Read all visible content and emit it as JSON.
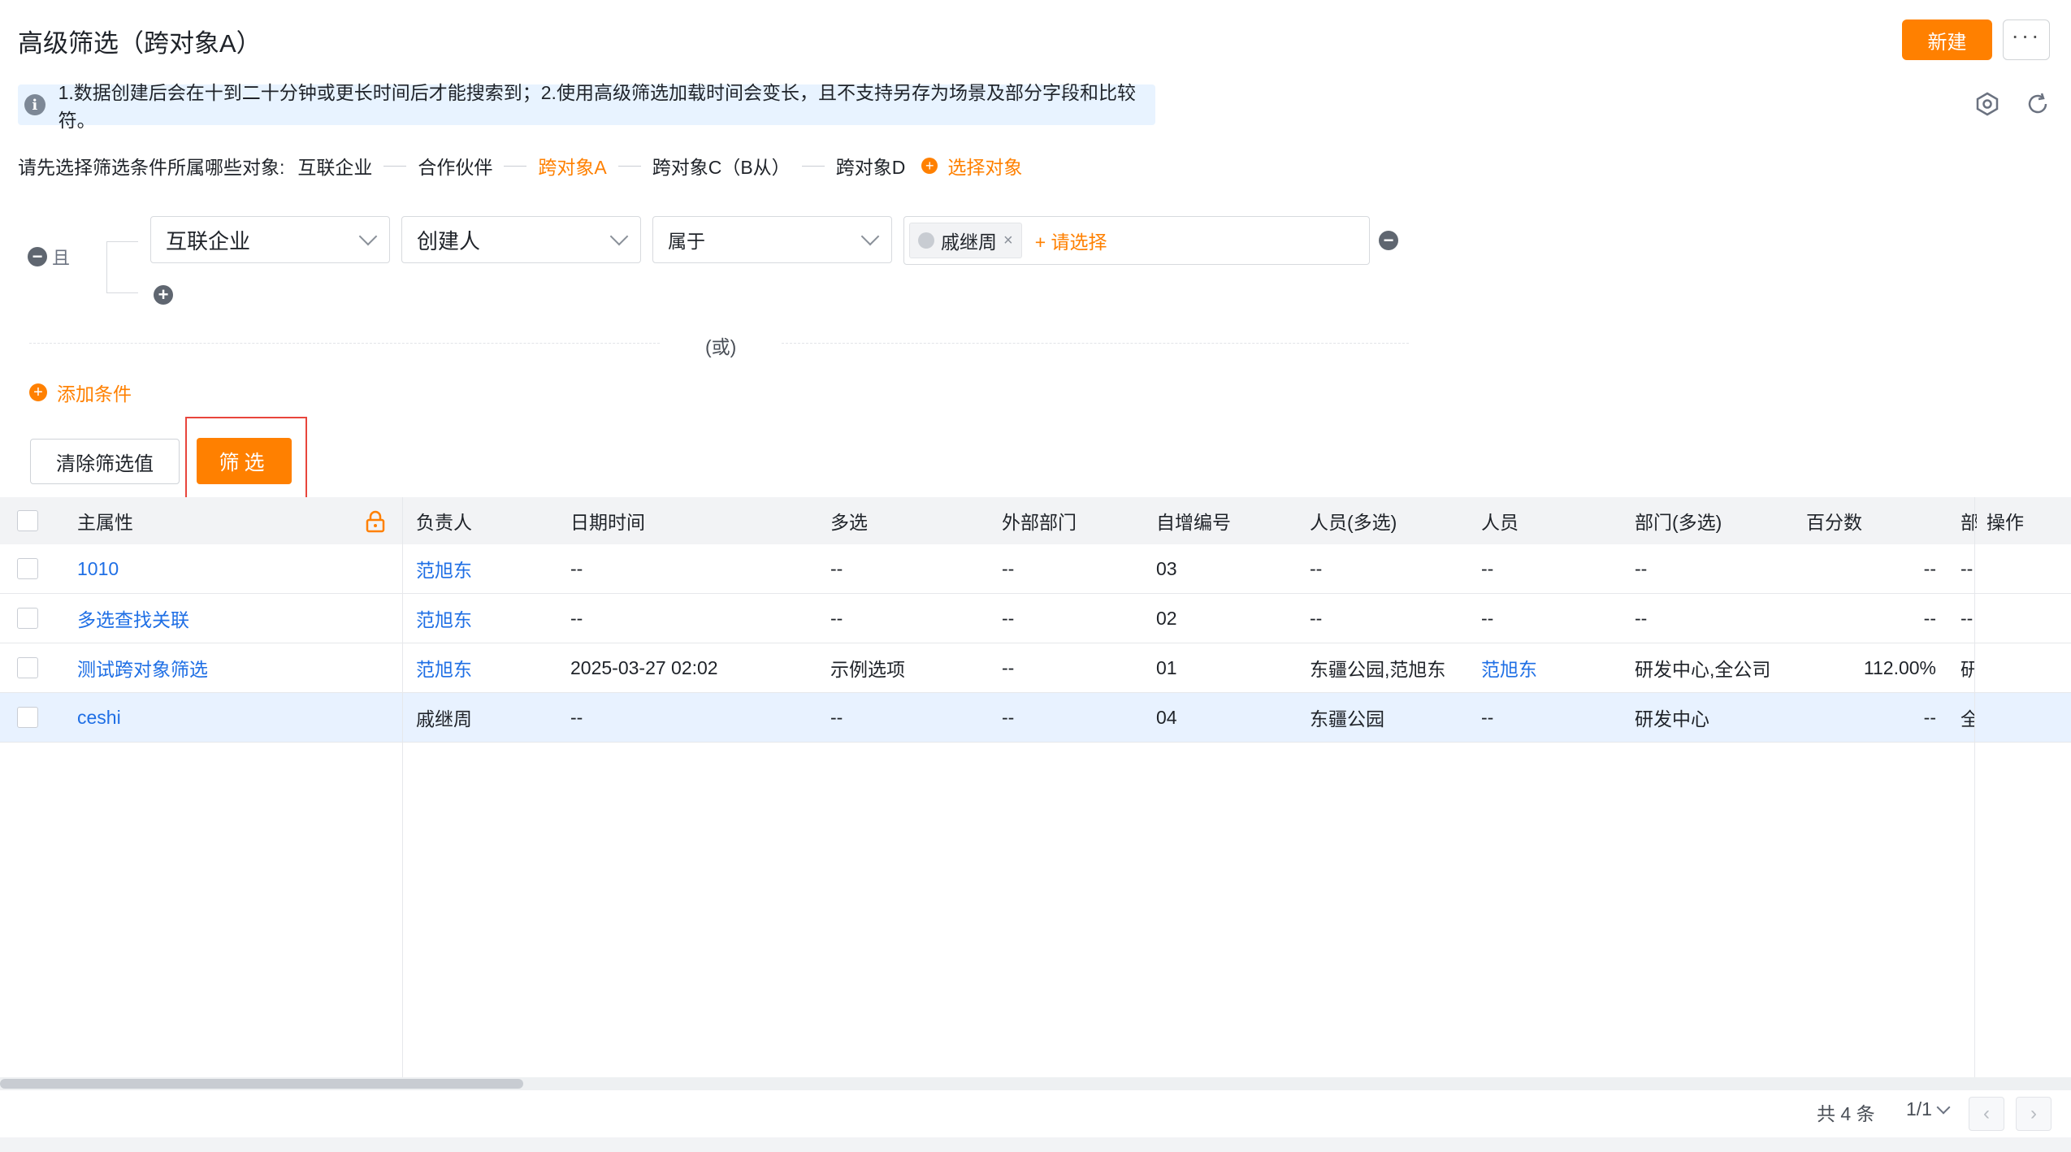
{
  "header": {
    "title": "高级筛选（跨对象A）",
    "new_label": "新建",
    "more_label": "···"
  },
  "notice": {
    "text": "1.数据创建后会在十到二十分钟或更长时间后才能搜索到；2.使用高级筛选加载时间会变长，且不支持另存为场景及部分字段和比较符。"
  },
  "objects": {
    "prompt": "请先选择筛选条件所属哪些对象:",
    "items": [
      "互联企业",
      "合作伙伴",
      "跨对象A",
      "跨对象C（B从）",
      "跨对象D"
    ],
    "active_index": 2,
    "select_label": "选择对象"
  },
  "condition": {
    "logic_label": "且",
    "object_value": "互联企业",
    "field_value": "创建人",
    "operator_value": "属于",
    "tag_value": "戚继周",
    "tag_add_label": "+ 请选择"
  },
  "or_label": "(或)",
  "add_condition_label": "添加条件",
  "buttons": {
    "clear_label": "清除筛选值",
    "filter_label": "筛选"
  },
  "table": {
    "columns": [
      "主属性",
      "负责人",
      "日期时间",
      "多选",
      "外部部门",
      "自增编号",
      "人员(多选)",
      "人员",
      "部门(多选)",
      "百分数",
      "部",
      "操作"
    ],
    "rows": [
      [
        "1010",
        "范旭东",
        "--",
        "--",
        "--",
        "03",
        "--",
        "--",
        "--",
        "--",
        "--"
      ],
      [
        "多选查找关联",
        "范旭东",
        "--",
        "--",
        "--",
        "02",
        "--",
        "--",
        "--",
        "--",
        "--"
      ],
      [
        "测试跨对象筛选",
        "范旭东",
        "2025-03-27 02:02",
        "示例选项",
        "--",
        "01",
        "东疆公园,范旭东",
        "范旭东",
        "研发中心,全公司",
        "112.00%",
        "研"
      ],
      [
        "ceshi",
        "戚继周",
        "--",
        "--",
        "--",
        "04",
        "东疆公园",
        "--",
        "研发中心",
        "--",
        "全"
      ]
    ],
    "highlighted_row": 3
  },
  "pagination": {
    "total_text": "共 4 条",
    "page_text": "1/1"
  },
  "colors": {
    "accent": "#ff8000",
    "link": "#1f6fe5",
    "notice_bg": "#e8f3ff",
    "highlight_border": "#e8453c"
  }
}
